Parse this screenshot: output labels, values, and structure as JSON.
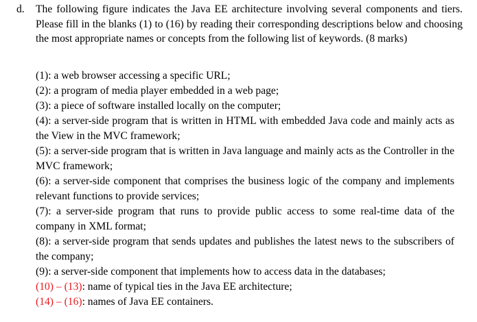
{
  "question": {
    "label": "d.",
    "text": "The following figure indicates the Java EE architecture involving several components and tiers. Please fill in the blanks (1) to (16) by reading their corresponding descriptions below and choosing the most appropriate names or concepts from the following list of keywords. (8 marks)"
  },
  "items": [
    {
      "num": "(1)",
      "text": ": a web browser accessing a specific URL;"
    },
    {
      "num": "(2)",
      "text": ": a program of media player embedded in a web page;"
    },
    {
      "num": "(3)",
      "text": ": a piece of software installed locally on the computer;"
    },
    {
      "num": "(4)",
      "text": ": a server-side program that is written in HTML with embedded Java code and mainly acts as the View in the MVC framework;"
    },
    {
      "num": "(5)",
      "text": ": a server-side program that is written in Java language and mainly acts as the Controller in the MVC framework;"
    },
    {
      "num": "(6)",
      "text": ": a server-side component that comprises the business logic of the company and implements relevant functions to provide services;"
    },
    {
      "num": "(7)",
      "text": ": a server-side program that runs to provide public access to some real-time data of the company in XML format;"
    },
    {
      "num": "(8)",
      "text": ": a server-side program that sends updates and publishes the latest news to the subscribers of the company;"
    },
    {
      "num": "(9)",
      "text": ": a server-side component that implements how to access data in the databases;"
    },
    {
      "num": "(10) – (13)",
      "text": ": name of typical ties in the Java EE architecture;"
    },
    {
      "num": "(14) – (16)",
      "text": ": names of Java EE containers."
    }
  ],
  "colors": {
    "highlight": "#e8181c",
    "text": "#000000"
  }
}
